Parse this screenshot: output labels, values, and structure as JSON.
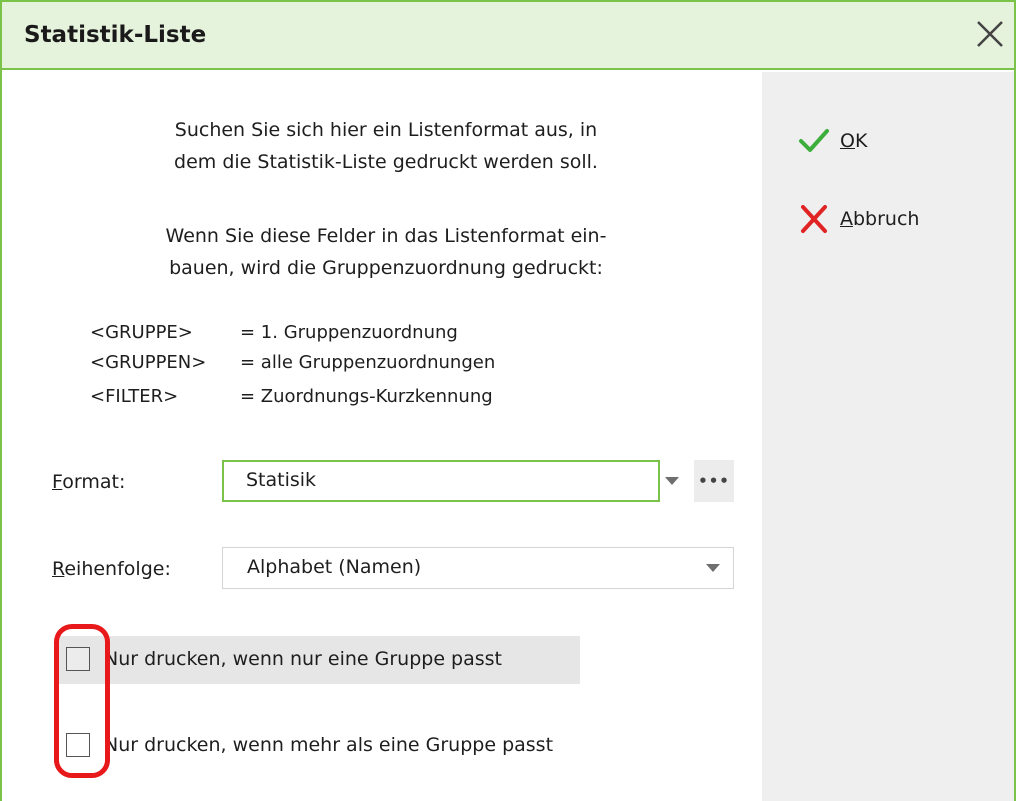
{
  "dialog": {
    "title": "Statistik-Liste",
    "border_color": "#7ac24a",
    "titlebar_bg": "#e5f3dd"
  },
  "intro": {
    "line1": "Suchen Sie sich hier ein Listenformat aus, in",
    "line2": "dem die Statistik-Liste gedruckt werden soll.",
    "line3": "Wenn Sie diese Felder in das Listenformat ein-",
    "line4": "bauen, wird die Gruppenzuordnung gedruckt:"
  },
  "fields": [
    {
      "key": "<GRUPPE>",
      "desc": "= 1. Gruppenzuordnung"
    },
    {
      "key": "<GRUPPEN>",
      "desc": "= alle Gruppenzuordnungen"
    },
    {
      "key": "<FILTER>",
      "desc": "= Zuordnungs-Kurzkennung"
    }
  ],
  "format": {
    "label_mnemonic": "F",
    "label_rest": "ormat:",
    "value": "Statisik",
    "more_label": "•••"
  },
  "order": {
    "label_mnemonic": "R",
    "label_rest": "eihenfolge:",
    "value": "Alphabet (Namen)"
  },
  "checkboxes": [
    {
      "label": "Nur drucken, wenn nur eine Gruppe passt",
      "checked": false
    },
    {
      "label": "Nur drucken, wenn mehr als eine Gruppe passt",
      "checked": false
    }
  ],
  "actions": {
    "ok_mnemonic": "O",
    "ok_rest": "K",
    "cancel_mnemonic": "A",
    "cancel_rest": "bbruch",
    "ok_icon": "check-icon",
    "cancel_icon": "cross-icon",
    "ok_color": "#3bae3b",
    "cancel_color": "#e02424"
  },
  "annotation": {
    "highlight_color": "#e8191b"
  }
}
